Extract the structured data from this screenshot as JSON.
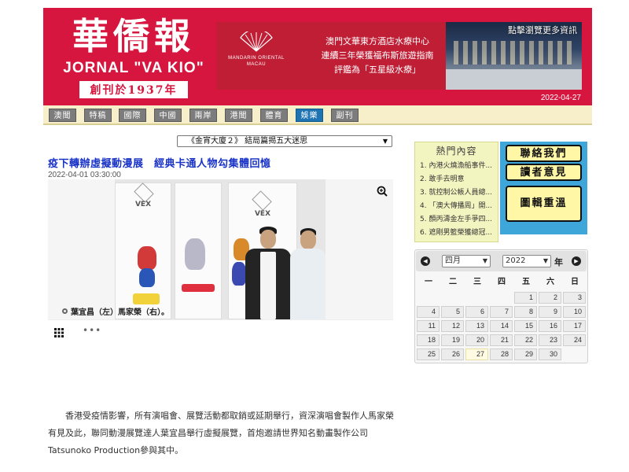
{
  "header": {
    "logo_cn": "華僑報",
    "logo_en": "JORNAL  \"VA KIO\"",
    "logo_since": "創刊於1937年",
    "date": "2022-04-27",
    "banner": {
      "brand": "MANDARIN ORIENTAL",
      "brand_sub": "MACAU",
      "line1": "澳門文華東方酒店水療中心",
      "line2": "連續三年榮獲福布斯旅遊指南",
      "line3": "評鑑為「五星級水療」",
      "more": "點擊瀏覽更多資訊"
    }
  },
  "nav": [
    {
      "label": "澳聞",
      "active": false
    },
    {
      "label": "特稿",
      "active": false
    },
    {
      "label": "國際",
      "active": false
    },
    {
      "label": "中國",
      "active": false
    },
    {
      "label": "兩岸",
      "active": false
    },
    {
      "label": "港聞",
      "active": false
    },
    {
      "label": "體育",
      "active": false
    },
    {
      "label": "娛樂",
      "active": true
    },
    {
      "label": "副刊",
      "active": false
    }
  ],
  "article": {
    "dropdown": "《金宵大廈２》 結局篇揭五大迷思",
    "title": "疫下轉辦虛擬動漫展　經典卡通人物勾集體回憶",
    "date": "2022-04-01 03:30:00",
    "vex_label": "VEX",
    "caption": "葉宜昌（左）馬家榮（右）。",
    "more_dots": "•••",
    "para1": "香港受疫情影響，所有演唱會、展覽活動都取銷或延期舉行，資深演唱會製作人馬家榮有見及此，聯同動漫展覽達人葉宜昌舉行虛擬展覽，首炮邀請世界知名動畫製作公司Tatsunoko Production參與其中。"
  },
  "sidebar": {
    "hot_title": "熱門內容",
    "hot_items": [
      "1. 內港火燒漁船事件...",
      "2. 敢手去明意",
      "3. 就控制公帳人員總...",
      "4. 「澳大傳播周」開...",
      "5. 顏丙濤金左手爭四...",
      "6. 遮剛男籃榮獲總冠..."
    ],
    "buttons": {
      "contact": "聯絡我們",
      "feedback": "讀者意見",
      "gallery": "圖輯重溫"
    }
  },
  "calendar": {
    "month": "四月",
    "year": "2022",
    "year_label": "年",
    "prev": "◀",
    "next": "▶",
    "weekdays": [
      "一",
      "二",
      "三",
      "四",
      "五",
      "六",
      "日"
    ],
    "days": [
      "1",
      "2",
      "3",
      "4",
      "5",
      "6",
      "7",
      "8",
      "9",
      "10",
      "11",
      "12",
      "13",
      "14",
      "15",
      "16",
      "17",
      "18",
      "19",
      "20",
      "21",
      "22",
      "23",
      "24",
      "25",
      "26",
      "27",
      "28",
      "29",
      "30"
    ],
    "first_weekday_index": 4,
    "today": "27"
  },
  "colors": {
    "brand_red": "#d6163f",
    "nav_active": "#1e73b3",
    "title_blue": "#1a33c7",
    "sidebar_blue": "#3ea6d8"
  }
}
